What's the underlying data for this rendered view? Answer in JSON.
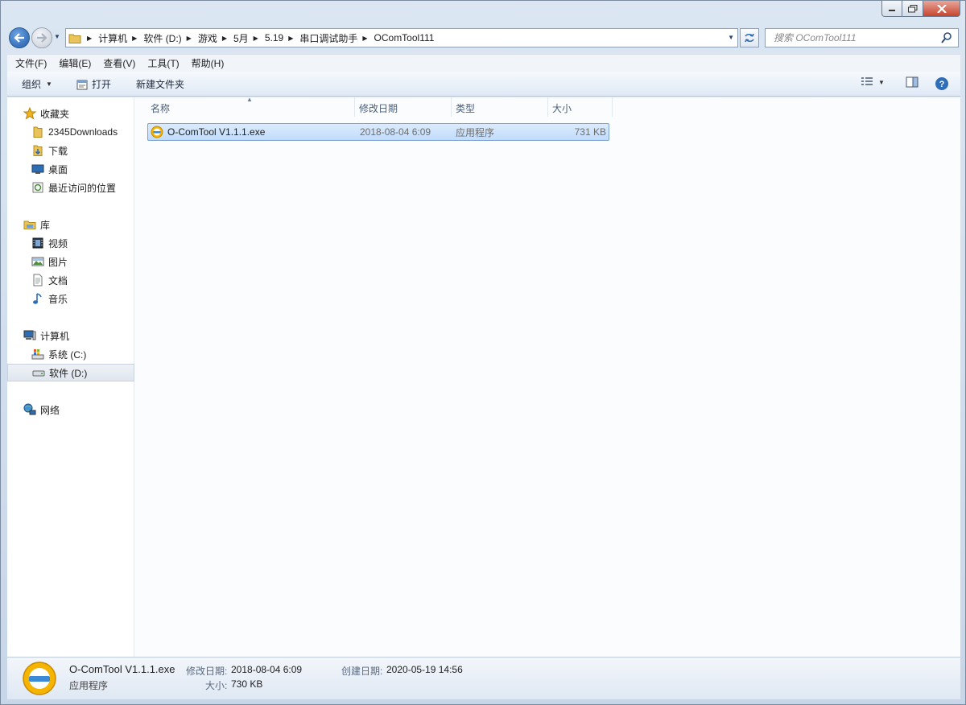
{
  "navigation": {
    "breadcrumbs": [
      "计算机",
      "软件 (D:)",
      "游戏",
      "5月",
      "5.19",
      "串口调试助手",
      "OComTool111"
    ],
    "search_placeholder": "搜索 OComTool111"
  },
  "menu": [
    "文件(F)",
    "编辑(E)",
    "查看(V)",
    "工具(T)",
    "帮助(H)"
  ],
  "toolbar": {
    "organize": "组织",
    "open": "打开",
    "new_folder": "新建文件夹"
  },
  "sidebar": {
    "favorites": {
      "label": "收藏夹",
      "items": [
        "2345Downloads",
        "下载",
        "桌面",
        "最近访问的位置"
      ]
    },
    "libraries": {
      "label": "库",
      "items": [
        "视频",
        "图片",
        "文档",
        "音乐"
      ]
    },
    "computer": {
      "label": "计算机",
      "items": [
        "系统 (C:)",
        "软件 (D:)"
      ]
    },
    "network": {
      "label": "网络"
    },
    "selected_item": "软件 (D:)"
  },
  "columns": {
    "name": "名称",
    "modified": "修改日期",
    "type": "类型",
    "size": "大小"
  },
  "files": [
    {
      "name": "O-ComTool V1.1.1.exe",
      "modified": "2018-08-04 6:09",
      "type": "应用程序",
      "size": "731 KB"
    }
  ],
  "details": {
    "name": "O-ComTool V1.1.1.exe",
    "type": "应用程序",
    "modified_label": "修改日期:",
    "modified": "2018-08-04 6:09",
    "size_label": "大小:",
    "size": "730 KB",
    "created_label": "创建日期:",
    "created": "2020-05-19 14:56"
  },
  "colors": {
    "selection": "#c9e0fc",
    "accent": "#2f6db8",
    "app_icon": "#f5b400"
  }
}
